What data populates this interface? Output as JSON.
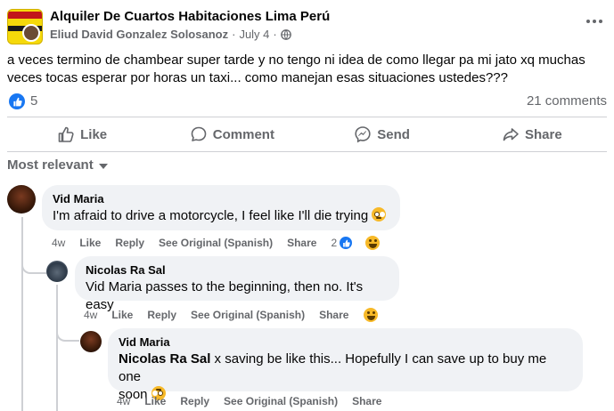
{
  "post": {
    "group_name": "Alquiler De Cuartos Habitaciones Lima Perú",
    "author": "Eliud David Gonzalez Solosanoz",
    "separator": "·",
    "date": "July 4",
    "dot": "·",
    "text": "a veces termino de chambear super tarde y no tengo ni idea de como llegar pa mi jato xq muchas veces tocas esperar por horas un taxi... como manejan esas situaciones ustedes???",
    "reaction_count": "5",
    "comments_count": "21 comments"
  },
  "actions": {
    "like": "Like",
    "comment": "Comment",
    "send": "Send",
    "share": "Share"
  },
  "sort_label": "Most relevant",
  "comments": [
    {
      "name": "Vid Maria",
      "text": "I'm afraid to drive a motorcycle, I feel like I'll die trying",
      "time": "4w",
      "like": "Like",
      "reply": "Reply",
      "see_original": "See Original (Spanish)",
      "share": "Share",
      "reaction_count": "2"
    },
    {
      "name": "Nicolas Ra Sal",
      "text": "Vid Maria passes to the beginning, then no. It's easy",
      "time": "4w",
      "like": "Like",
      "reply": "Reply",
      "see_original": "See Original (Spanish)",
      "share": "Share"
    },
    {
      "name": "Vid Maria",
      "mention": "Nicolas Ra Sal",
      "text_line1": " x saving be like this... Hopefully I can save up to buy me one",
      "text_line2": "soon",
      "time": "4w",
      "like": "Like",
      "reply": "Reply",
      "see_original": "See Original (Spanish)",
      "share": "Share"
    }
  ],
  "colors": {
    "accent": "#1877f2",
    "secondary_text": "#65676b",
    "bubble": "#f0f2f5",
    "divider": "#ced0d4"
  }
}
